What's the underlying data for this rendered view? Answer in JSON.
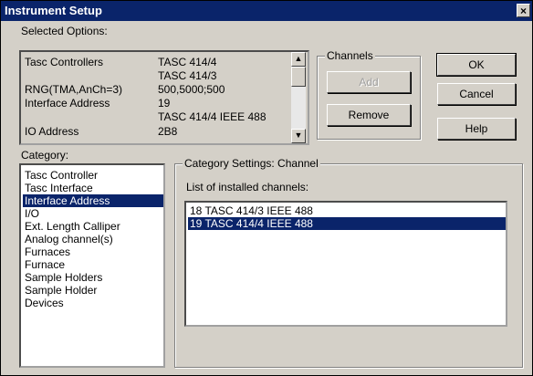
{
  "window": {
    "title": "Instrument Setup",
    "close_glyph": "×"
  },
  "selected_options": {
    "label": "Selected Options:",
    "rows": [
      {
        "name": "Tasc Controllers",
        "value": "TASC 414/4"
      },
      {
        "name": "",
        "value": "TASC 414/3"
      },
      {
        "name": "RNG(TMA,AnCh=3)",
        "value": "500,5000;500"
      },
      {
        "name": "Interface Address",
        "value": "19"
      },
      {
        "name": "",
        "value": "TASC 414/4 IEEE 488"
      },
      {
        "name": "IO Address",
        "value": "2B8"
      }
    ]
  },
  "channels": {
    "title": "Channels",
    "add_label": "Add",
    "remove_label": "Remove"
  },
  "buttons": {
    "ok": "OK",
    "cancel": "Cancel",
    "help": "Help"
  },
  "category": {
    "label": "Category:",
    "items": [
      "Tasc Controller",
      "Tasc Interface",
      "Interface Address",
      "I/O",
      "Ext. Length Calliper",
      "Analog channel(s)",
      "Furnaces",
      "Furnace",
      "Sample Holders",
      "Sample Holder",
      "Devices"
    ],
    "selected": "Interface Address"
  },
  "category_settings": {
    "title": "Category Settings: Channel",
    "list_label": "List of installed channels:",
    "channels": [
      "18 TASC 414/3 IEEE 488",
      "19 TASC 414/4 IEEE 488"
    ],
    "selected": "19 TASC 414/4 IEEE 488"
  },
  "colors": {
    "dialog_bg": "#d4d0c8",
    "title_bg": "#0a246a",
    "selection": "#0a246a"
  }
}
